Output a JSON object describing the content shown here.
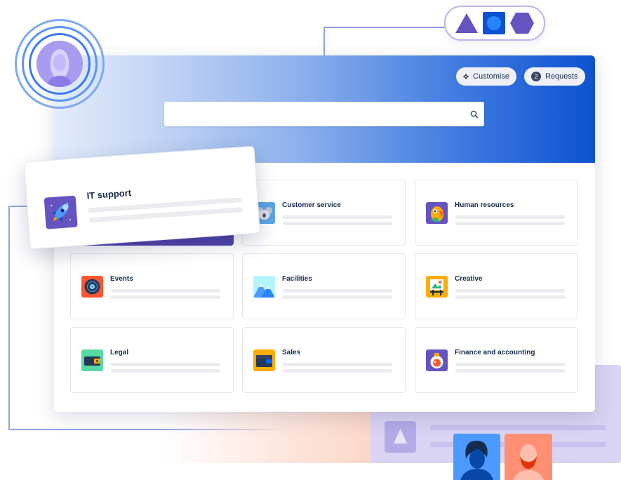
{
  "header": {
    "customise_label": "Customise",
    "customise_icon": "gear-icon",
    "requests_count": "2",
    "requests_label": "Requests",
    "search_icon": "search-icon"
  },
  "featured_card": {
    "label": "IT support",
    "icon": "rocket-icon"
  },
  "categories": [
    {
      "label": "Customer service",
      "icon": "koala-icon",
      "color": "#5ba7e8"
    },
    {
      "label": "Human resources",
      "icon": "parrot-icon",
      "color": "#6554c0"
    },
    {
      "label": "Events",
      "icon": "vinyl-record-icon",
      "color": "#ff5630"
    },
    {
      "label": "Facilities",
      "icon": "mountains-icon",
      "color": "#79e2f2"
    },
    {
      "label": "Creative",
      "icon": "easel-icon",
      "color": "#ffab00"
    },
    {
      "label": "Legal",
      "icon": "briefcase-icon",
      "color": "#36b37e"
    },
    {
      "label": "Sales",
      "icon": "wallet-icon",
      "color": "#ffab00"
    },
    {
      "label": "Finance and accounting",
      "icon": "piggy-bank-icon",
      "color": "#6554c0"
    }
  ],
  "colors": {
    "accent_blue": "#0c52d0",
    "purple": "#6554c0",
    "lilac_panel": "#d9d4f3"
  }
}
